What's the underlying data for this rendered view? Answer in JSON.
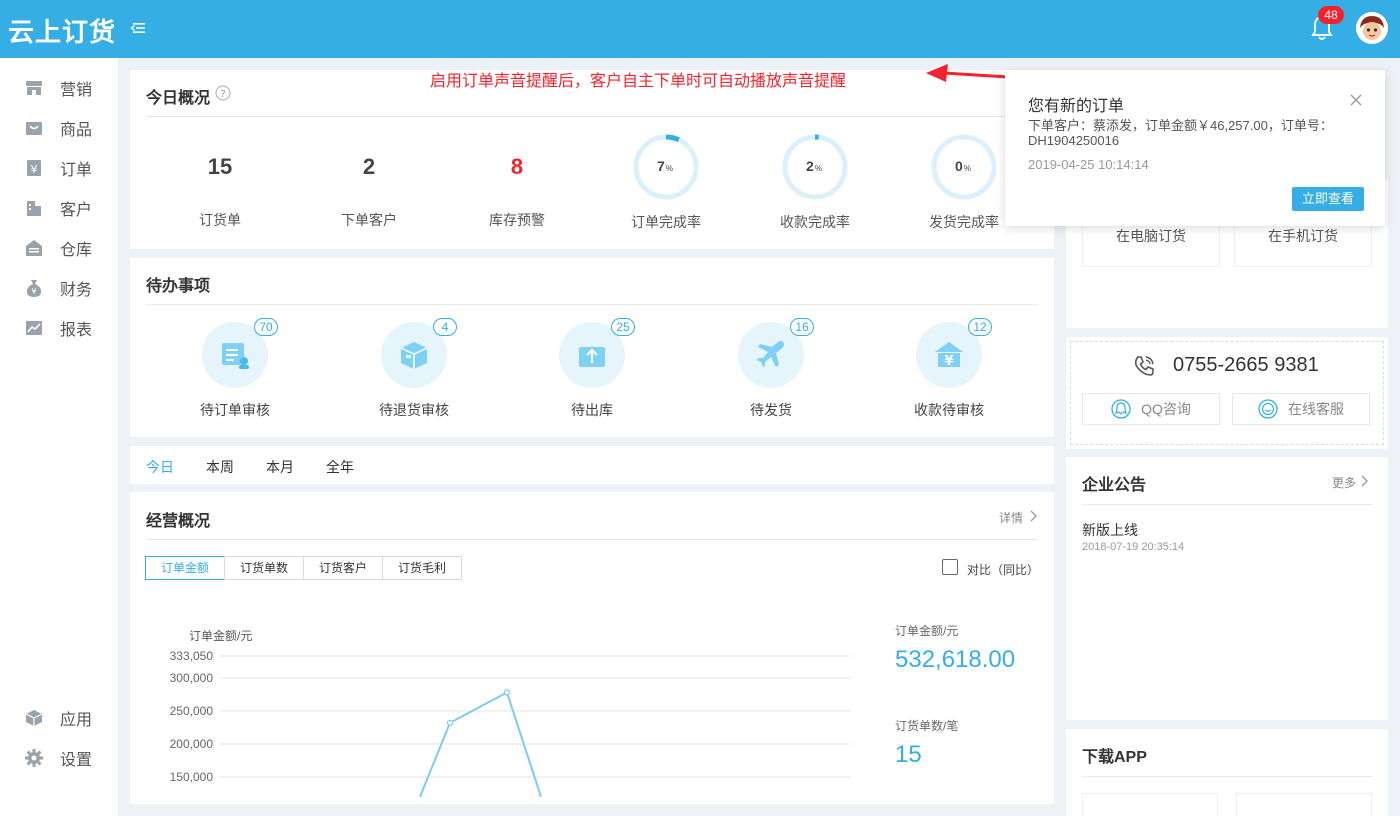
{
  "header": {
    "logo": "云上订货",
    "notification_count": "48"
  },
  "sidebar": {
    "items": [
      {
        "label": "营销",
        "icon": "store-icon"
      },
      {
        "label": "商品",
        "icon": "bag-icon"
      },
      {
        "label": "订单",
        "icon": "yen-doc-icon"
      },
      {
        "label": "客户",
        "icon": "building-icon"
      },
      {
        "label": "仓库",
        "icon": "warehouse-icon"
      },
      {
        "label": "财务",
        "icon": "money-bag-icon"
      },
      {
        "label": "报表",
        "icon": "chart-icon"
      }
    ],
    "bottom_items": [
      {
        "label": "应用",
        "icon": "cube-icon"
      },
      {
        "label": "设置",
        "icon": "gear-icon"
      }
    ]
  },
  "overview": {
    "title": "今日概况",
    "stats": [
      {
        "value": "15",
        "label": "订货单"
      },
      {
        "value": "2",
        "label": "下单客户"
      },
      {
        "value": "8",
        "label": "库存预警"
      }
    ],
    "rings": [
      {
        "value": "7",
        "unit": "%",
        "label": "订单完成率",
        "percent": 7
      },
      {
        "value": "2",
        "unit": "%",
        "label": "收款完成率",
        "percent": 2
      },
      {
        "value": "0",
        "unit": "%",
        "label": "发货完成率",
        "percent": 0
      }
    ]
  },
  "annotation": "启用订单声音提醒后，客户自主下单时可自动播放声音提醒",
  "todo": {
    "title": "待办事项",
    "items": [
      {
        "label": "待订单审核",
        "count": "70"
      },
      {
        "label": "待退货审核",
        "count": "4"
      },
      {
        "label": "待出库",
        "count": "25"
      },
      {
        "label": "待发货",
        "count": "16"
      },
      {
        "label": "收款待审核",
        "count": "12"
      }
    ]
  },
  "period_tabs": [
    "今日",
    "本周",
    "本月",
    "全年"
  ],
  "business": {
    "title": "经营概况",
    "detail_link": "详情",
    "segments": [
      "订单金额",
      "订货单数",
      "订货客户",
      "订货毛利"
    ],
    "compare_label": "对比（同比）",
    "metrics": [
      {
        "label": "订单金额/元",
        "value": "532,618.00"
      },
      {
        "label": "订货单数/笔",
        "value": "15"
      }
    ]
  },
  "chart_data": {
    "type": "line",
    "ylabel": "订单金额/元",
    "y_ticks": [
      "333,050",
      "300,000",
      "250,000",
      "200,000",
      "150,000"
    ],
    "ylim": [
      150000,
      333050
    ],
    "x": [
      0,
      1,
      2,
      3
    ],
    "series": [
      {
        "values": [
          120000,
          232000,
          278000,
          120000
        ]
      }
    ],
    "grid": true,
    "color": "#7ecaf0"
  },
  "order_ways": [
    {
      "label": "在电脑订货"
    },
    {
      "label": "在手机订货"
    }
  ],
  "service": {
    "phone": "0755-2665 9381",
    "buttons": [
      {
        "label": "QQ咨询"
      },
      {
        "label": "在线客服"
      }
    ]
  },
  "announcements": {
    "title": "企业公告",
    "more": "更多",
    "items": [
      {
        "title": "新版上线",
        "time": "2018-07-19 20:35:14"
      }
    ]
  },
  "download": {
    "title": "下载APP"
  },
  "notification": {
    "title": "您有新的订单",
    "body": "下单客户：蔡添发，订单金额￥46,257.00，订单号：DH1904250016",
    "time": "2019-04-25 10:14:14",
    "button": "立即查看"
  },
  "colors": {
    "primary": "#35aee6",
    "danger": "#f5222d"
  }
}
